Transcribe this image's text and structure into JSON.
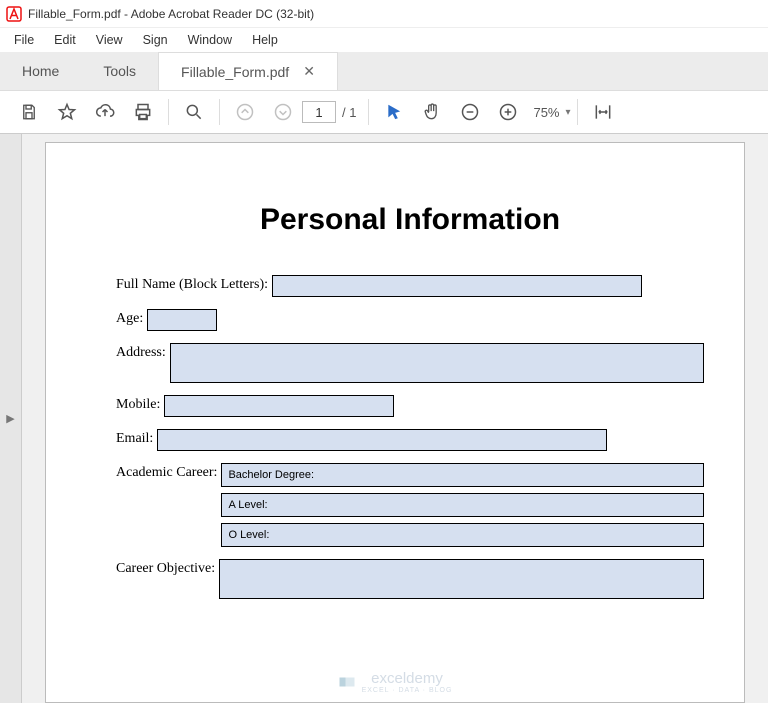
{
  "titlebar": {
    "text": "Fillable_Form.pdf - Adobe Acrobat Reader DC (32-bit)"
  },
  "menubar": {
    "items": [
      "File",
      "Edit",
      "View",
      "Sign",
      "Window",
      "Help"
    ]
  },
  "tabs": {
    "home": "Home",
    "tools": "Tools",
    "active": "Fillable_Form.pdf"
  },
  "toolbar": {
    "page_current": "1",
    "page_total": "/ 1",
    "zoom": "75%"
  },
  "form": {
    "heading": "Personal Information",
    "labels": {
      "full_name": "Full Name (Block Letters):",
      "age": "Age:",
      "address": "Address:",
      "mobile": "Mobile:",
      "email": "Email:",
      "academic": "Academic Career:",
      "objective": "Career Objective:"
    },
    "academic_options": {
      "bachelor": "Bachelor Degree:",
      "alevel": "A Level:",
      "olevel": "O Level:"
    }
  },
  "watermark": {
    "brand": "exceldemy",
    "sub": "EXCEL · DATA · BLOG"
  }
}
